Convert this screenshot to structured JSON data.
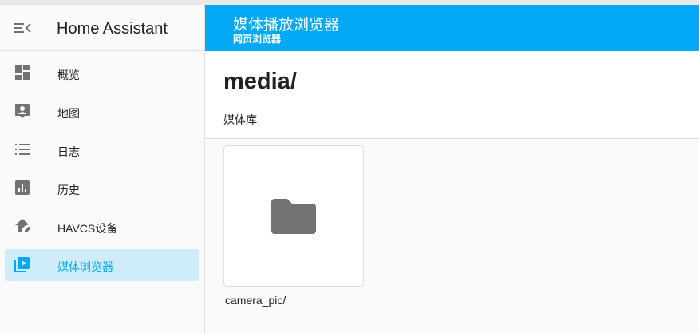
{
  "sidebar": {
    "title": "Home Assistant",
    "items": [
      {
        "label": "概览",
        "icon": "dashboard-icon"
      },
      {
        "label": "地图",
        "icon": "map-account-icon"
      },
      {
        "label": "日志",
        "icon": "logbook-list-icon"
      },
      {
        "label": "历史",
        "icon": "history-chart-icon"
      },
      {
        "label": "HAVCS设备",
        "icon": "home-edit-icon"
      },
      {
        "label": "媒体浏览器",
        "icon": "media-play-icon",
        "selected": true
      }
    ]
  },
  "header": {
    "title": "媒体播放浏览器",
    "subtitle": "网页浏览器"
  },
  "main": {
    "path_title": "media/",
    "library_label": "媒体库",
    "items": [
      {
        "name": "camera_pic/",
        "icon": "folder-icon"
      }
    ]
  },
  "colors": {
    "accent": "#03a9f4",
    "selected_bg": "#cfecfa",
    "icon_gray": "#727272"
  }
}
